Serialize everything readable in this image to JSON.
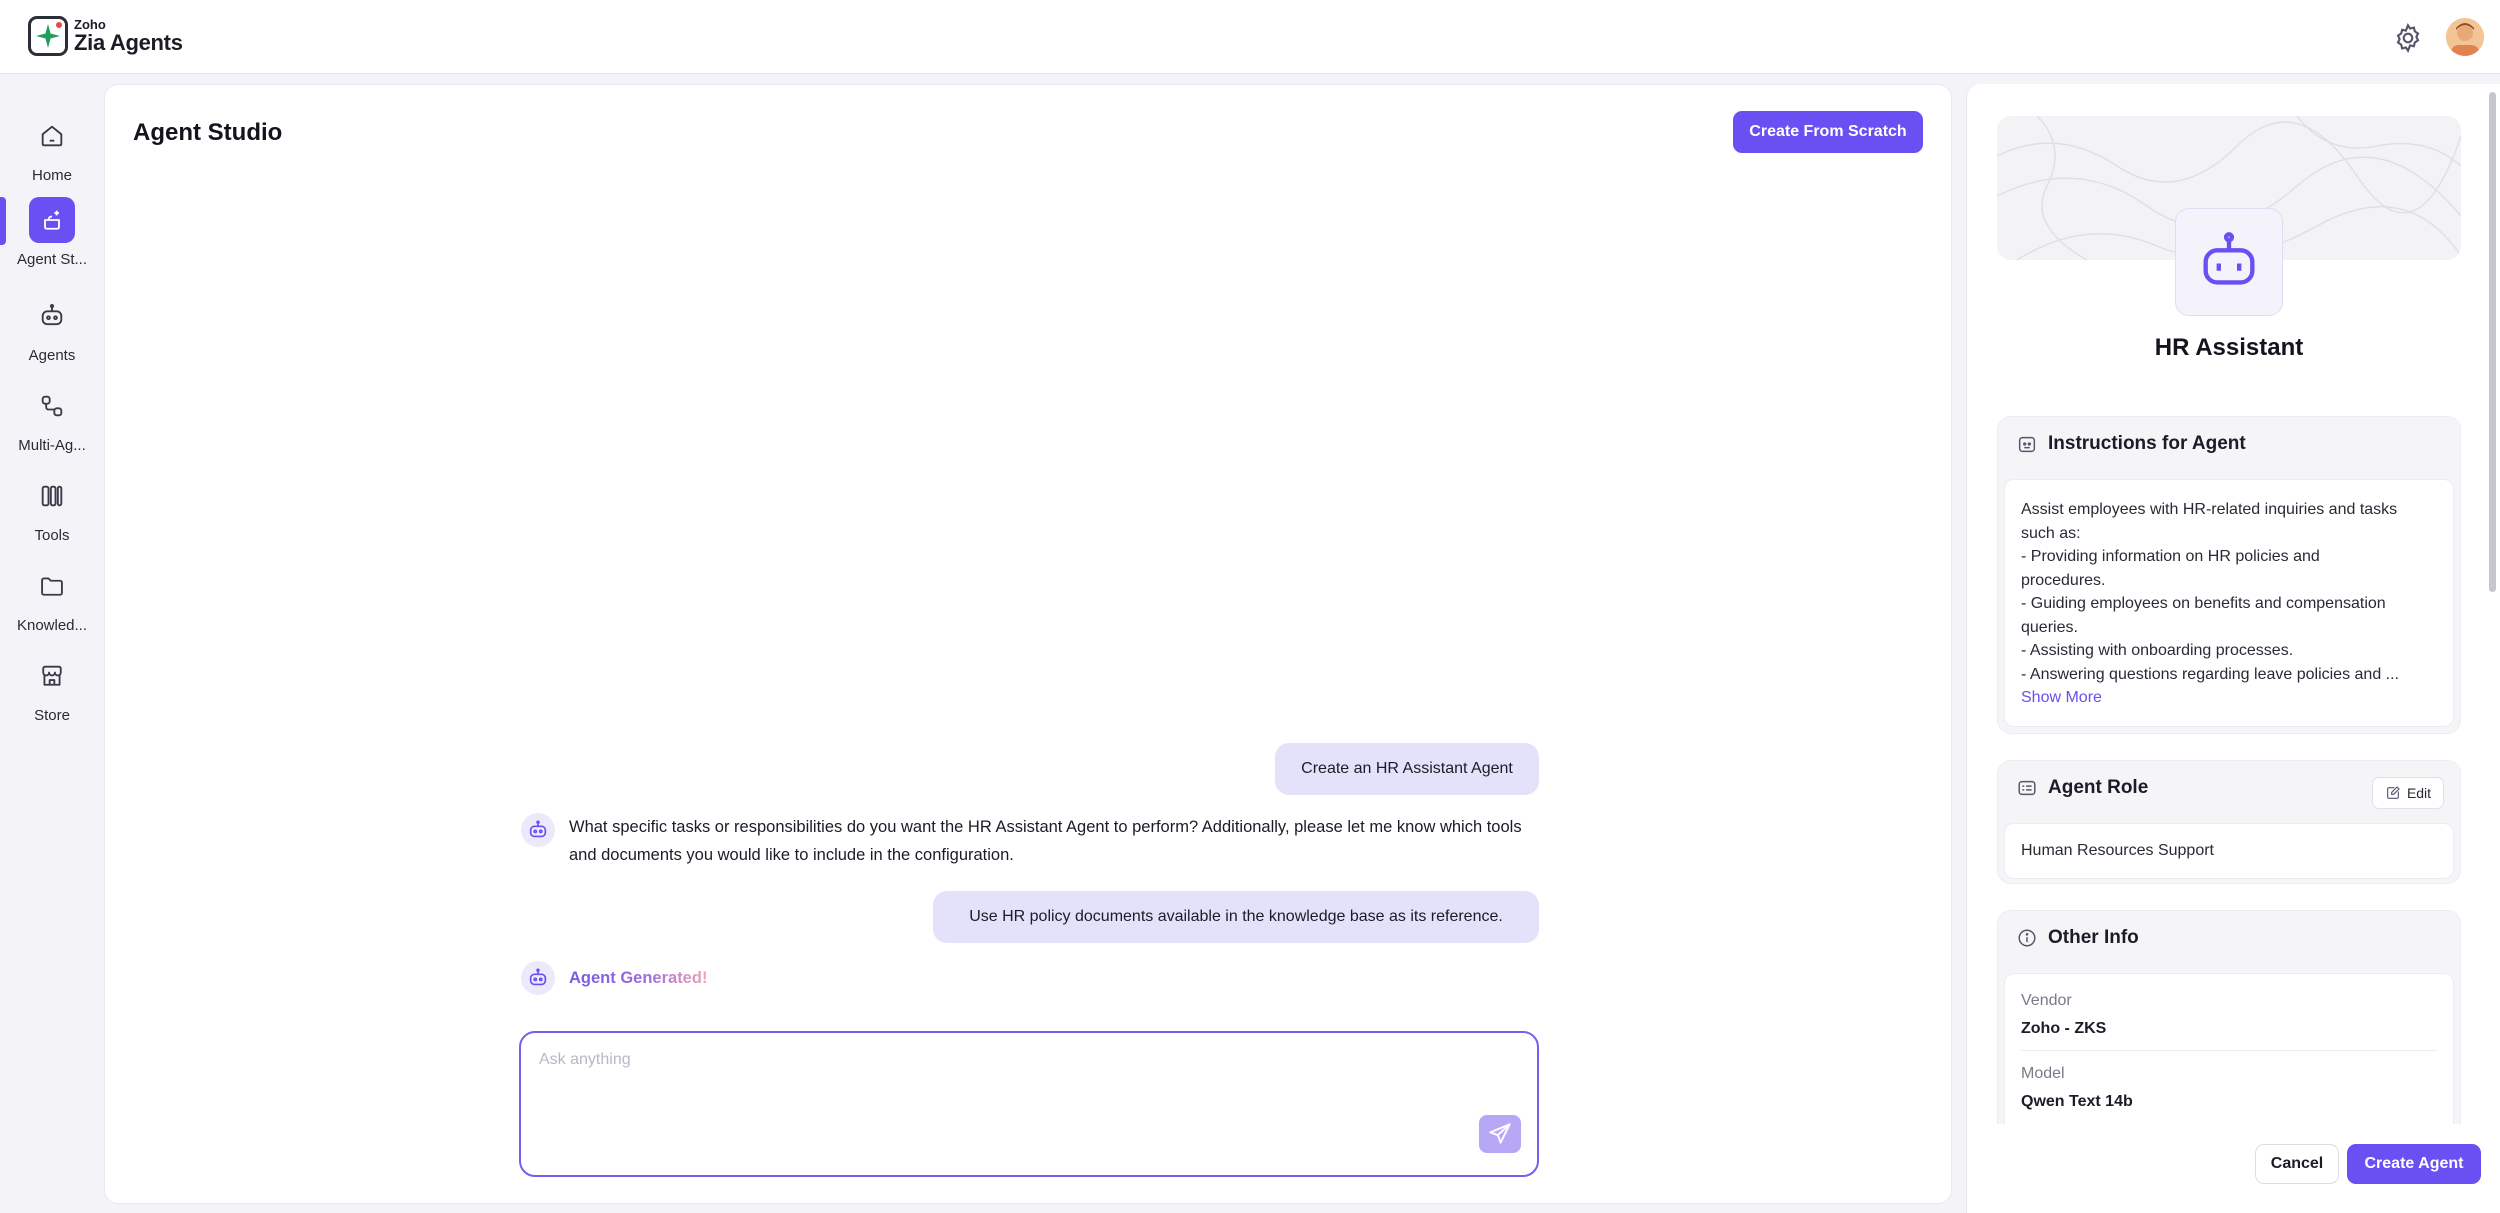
{
  "brand": {
    "small": "Zoho",
    "name": "Zia Agents"
  },
  "nav": {
    "items": [
      {
        "label": "Home",
        "icon": "home-icon"
      },
      {
        "label": "Agent St...",
        "icon": "agent-studio-icon",
        "active": true
      },
      {
        "label": "Agents",
        "icon": "robot-icon"
      },
      {
        "label": "Multi-Ag...",
        "icon": "workflow-icon"
      },
      {
        "label": "Tools",
        "icon": "tools-icon"
      },
      {
        "label": "Knowled...",
        "icon": "folder-icon"
      },
      {
        "label": "Store",
        "icon": "store-icon"
      }
    ]
  },
  "main": {
    "title": "Agent Studio",
    "create_scratch_label": "Create From Scratch",
    "messages": {
      "user_1": "Create an HR Assistant Agent",
      "bot_1": "What specific tasks or responsibilities do you want the HR Assistant Agent to perform? Additionally, please let me know which tools and documents you would like to include in the configuration.",
      "user_2": "Use HR policy documents available in the knowledge base as its reference.",
      "bot_2": "Agent Generated!"
    },
    "composer": {
      "placeholder": "Ask anything",
      "value": ""
    }
  },
  "agent": {
    "name": "HR Assistant",
    "instructions": {
      "title": "Instructions for Agent",
      "lines": [
        "Assist employees with HR-related inquiries and tasks",
        "such as:",
        "- Providing information on HR policies and",
        "procedures.",
        "- Guiding employees on benefits and compensation",
        "queries.",
        "- Assisting with onboarding processes.",
        "- Answering questions regarding leave policies and ..."
      ],
      "show_more": "Show More"
    },
    "role": {
      "title": "Agent Role",
      "edit_label": "Edit",
      "value": "Human Resources Support"
    },
    "other_info": {
      "title": "Other Info",
      "vendor_label": "Vendor",
      "vendor_value": "Zoho - ZKS",
      "model_label": "Model",
      "model_value": "Qwen Text 14b"
    }
  },
  "footer": {
    "cancel_label": "Cancel",
    "create_label": "Create Agent"
  },
  "colors": {
    "accent": "#6a4ff2",
    "user_bubble": "#e4e1fa",
    "send_button": "#b6a8f5"
  }
}
